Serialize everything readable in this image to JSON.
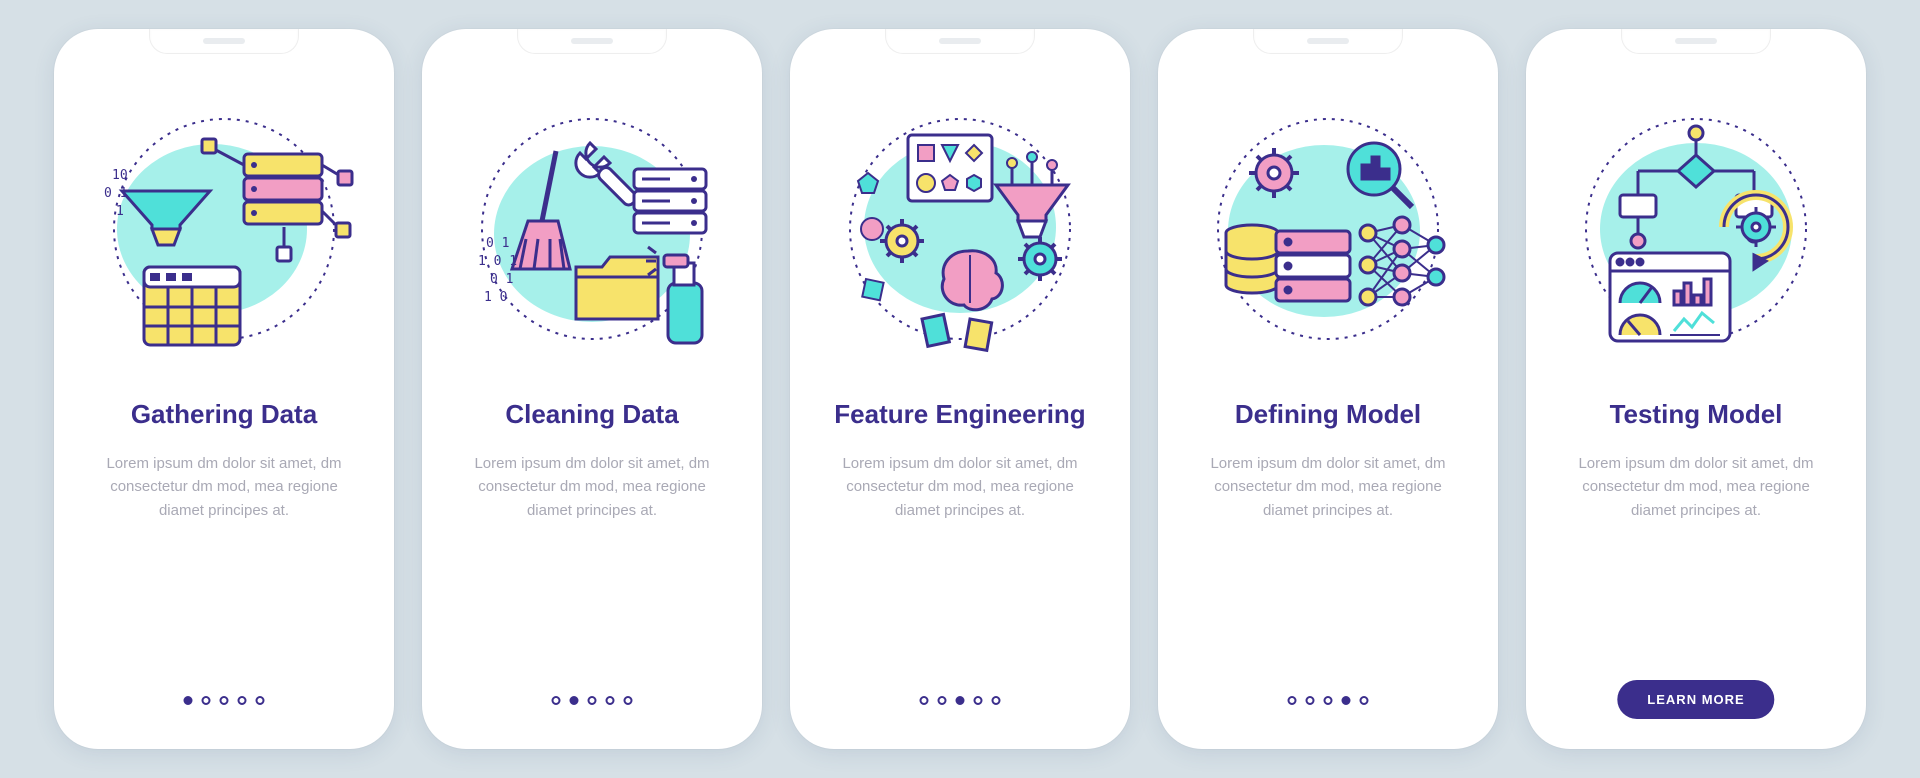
{
  "colors": {
    "accent_purple": "#3b2e8c",
    "aqua": "#4fe0d9",
    "pink": "#f29ec4",
    "yellow": "#f7e36b",
    "outline": "#3b2e8c"
  },
  "screens": [
    {
      "title": "Gathering Data",
      "desc": "Lorem ipsum dm dolor sit amet, dm consectetur dm mod, mea regione diamet principes at.",
      "active_dot": 0,
      "total_dots": 5,
      "has_button": false
    },
    {
      "title": "Cleaning Data",
      "desc": "Lorem ipsum dm dolor sit amet, dm consectetur dm mod, mea regione diamet principes at.",
      "active_dot": 1,
      "total_dots": 5,
      "has_button": false
    },
    {
      "title": "Feature Engineering",
      "desc": "Lorem ipsum dm dolor sit amet, dm consectetur dm mod, mea regione diamet principes at.",
      "active_dot": 2,
      "total_dots": 5,
      "has_button": false
    },
    {
      "title": "Defining Model",
      "desc": "Lorem ipsum dm dolor sit amet, dm consectetur dm mod, mea regione diamet principes at.",
      "active_dot": 3,
      "total_dots": 5,
      "has_button": false
    },
    {
      "title": "Testing Model",
      "desc": "Lorem ipsum dm dolor sit amet, dm consectetur dm mod, mea regione diamet principes at.",
      "active_dot": 4,
      "total_dots": 5,
      "has_button": true,
      "button_label": "LEARN MORE"
    }
  ]
}
